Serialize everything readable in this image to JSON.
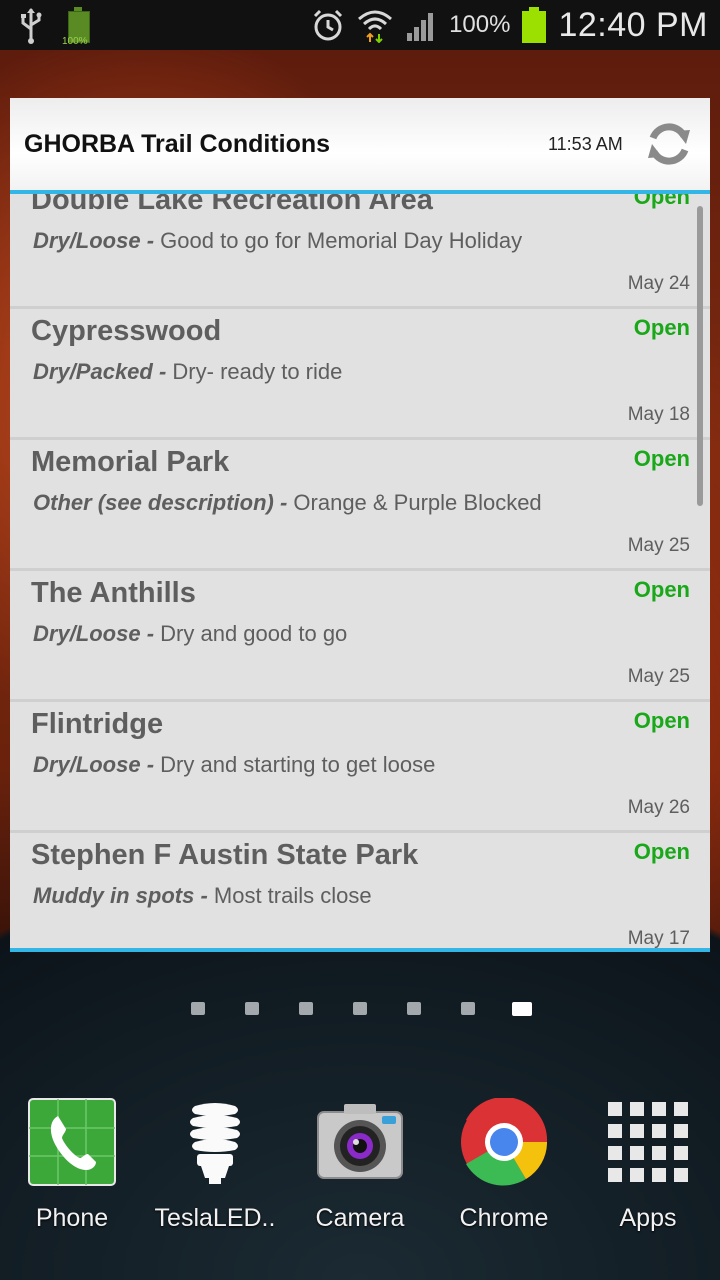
{
  "status_bar": {
    "usb_icon": "usb-icon",
    "small_battery_label": "100%",
    "battery_percent": "100%",
    "time": "12:40 PM",
    "icons": [
      "alarm-icon",
      "wifi-icon",
      "signal-icon",
      "battery-icon"
    ]
  },
  "widget": {
    "title": "GHORBA Trail Conditions",
    "updated_time": "11:53 AM",
    "refresh_icon": "refresh-icon",
    "accent_color": "#33b5e5",
    "open_color": "#1aa81a",
    "trails": [
      {
        "name": "Double Lake Recreation Area",
        "condition": "Dry/Loose",
        "separator": " - ",
        "description": "Good to go for Memorial Day Holiday",
        "status": "Open",
        "date": "May 24"
      },
      {
        "name": "Cypresswood",
        "condition": "Dry/Packed",
        "separator": " - ",
        "description": "Dry- ready to ride",
        "status": "Open",
        "date": "May 18"
      },
      {
        "name": "Memorial Park",
        "condition": "Other (see description)",
        "separator": " - ",
        "description": "Orange & Purple Blocked",
        "status": "Open",
        "date": "May 25"
      },
      {
        "name": "The Anthills",
        "condition": "Dry/Loose",
        "separator": " - ",
        "description": "Dry and good to go",
        "status": "Open",
        "date": "May 25"
      },
      {
        "name": "Flintridge",
        "condition": "Dry/Loose",
        "separator": " - ",
        "description": "Dry and starting to get loose",
        "status": "Open",
        "date": "May 26"
      },
      {
        "name": "Stephen F Austin State Park",
        "condition": "Muddy in spots",
        "separator": " - ",
        "description": "Most trails close",
        "status": "Open",
        "date": "May 17"
      }
    ]
  },
  "pager": {
    "pages": 7,
    "active_index": 6
  },
  "dock": {
    "items": [
      {
        "label": "Phone",
        "icon": "phone-icon"
      },
      {
        "label": "TeslaLED..",
        "icon": "lightbulb-icon"
      },
      {
        "label": "Camera",
        "icon": "camera-icon"
      },
      {
        "label": "Chrome",
        "icon": "chrome-icon"
      },
      {
        "label": "Apps",
        "icon": "apps-grid-icon"
      }
    ]
  }
}
